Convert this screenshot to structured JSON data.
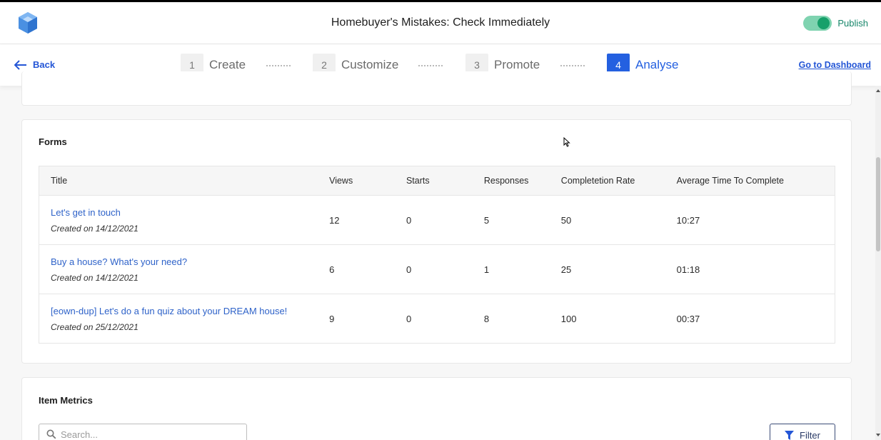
{
  "header": {
    "title": "Homebuyer's Mistakes: Check Immediately",
    "publish_label": "Publish",
    "publish_on": true,
    "accent_color": "#17a06a"
  },
  "nav": {
    "back_label": "Back",
    "dashboard_label": "Go to Dashboard",
    "steps": [
      {
        "number": "1",
        "label": "Create",
        "active": false
      },
      {
        "number": "2",
        "label": "Customize",
        "active": false
      },
      {
        "number": "3",
        "label": "Promote",
        "active": false
      },
      {
        "number": "4",
        "label": "Analyse",
        "active": true
      }
    ],
    "active_color": "#2460e0"
  },
  "forms": {
    "title": "Forms",
    "columns": [
      "Title",
      "Views",
      "Starts",
      "Responses",
      "Completetion Rate",
      "Average Time To Complete"
    ],
    "rows": [
      {
        "title": "Let's get in touch",
        "created": "Created on 14/12/2021",
        "views": "12",
        "starts": "0",
        "responses": "5",
        "completion_rate": "50",
        "avg_time": "10:27"
      },
      {
        "title": "Buy a house? What's your need?",
        "created": "Created on 14/12/2021",
        "views": "6",
        "starts": "0",
        "responses": "1",
        "completion_rate": "25",
        "avg_time": "01:18"
      },
      {
        "title": "[eown-dup] Let's do a fun quiz about your DREAM house!",
        "created": "Created on 25/12/2021",
        "views": "9",
        "starts": "0",
        "responses": "8",
        "completion_rate": "100",
        "avg_time": "00:37"
      }
    ]
  },
  "item_metrics": {
    "title": "Item Metrics",
    "search_placeholder": "Search...",
    "filter_label": "Filter"
  }
}
